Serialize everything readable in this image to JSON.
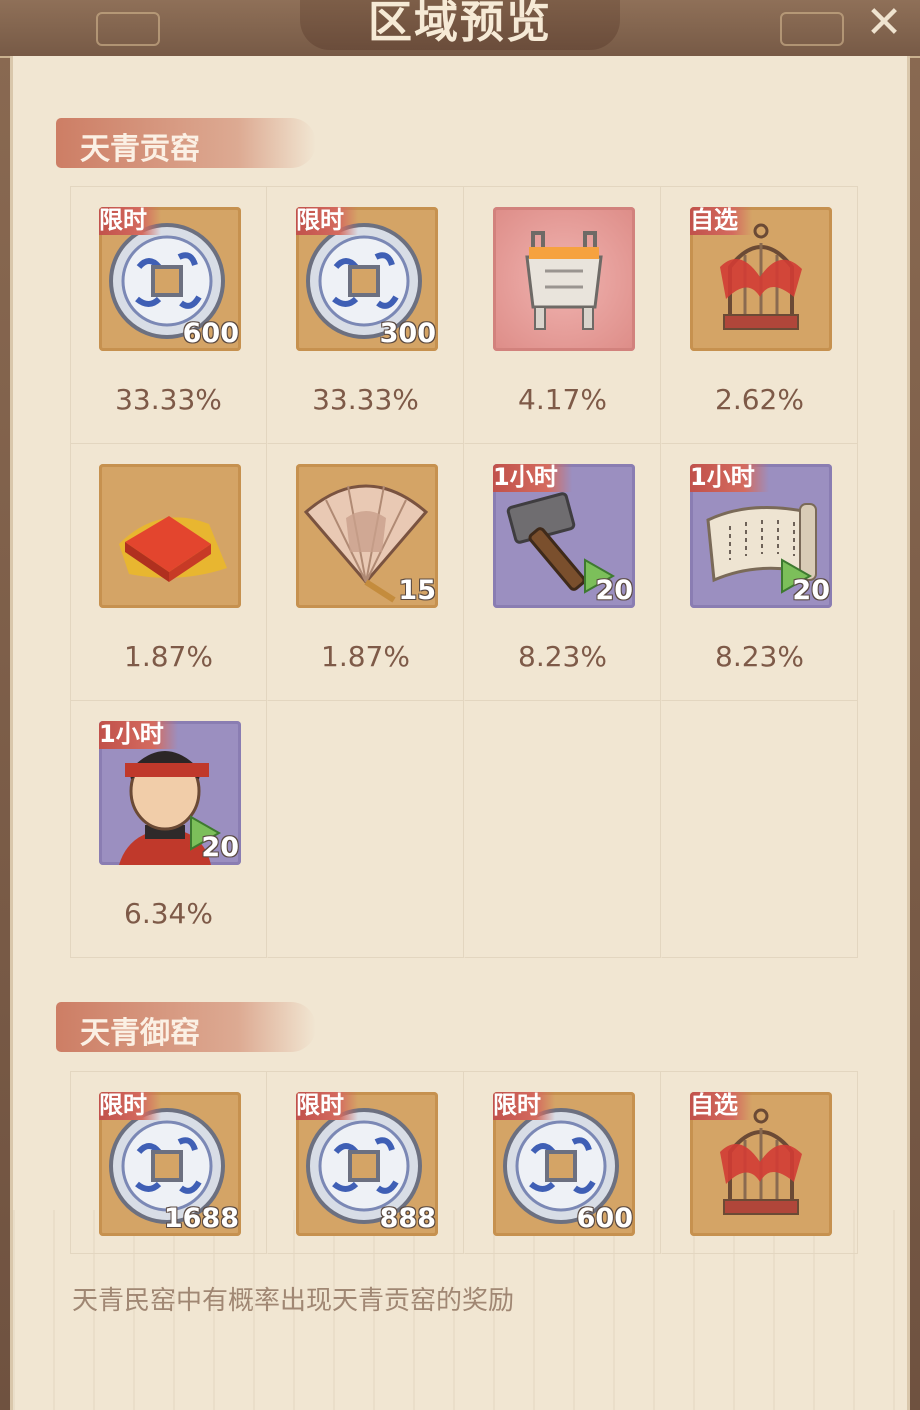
{
  "header": {
    "title": "区域预览"
  },
  "sections": [
    {
      "label": "天青贡窑",
      "items": [
        {
          "icon": "coin-icon",
          "tag": "限时",
          "qty": "600",
          "rate": "33.33%",
          "bg": "gold"
        },
        {
          "icon": "coin-icon",
          "tag": "限时",
          "qty": "300",
          "rate": "33.33%",
          "bg": "gold"
        },
        {
          "icon": "bronze-ding-icon",
          "tag": "",
          "qty": "",
          "rate": "4.17%",
          "bg": "red"
        },
        {
          "icon": "birdcage-icon",
          "tag": "自选",
          "qty": "",
          "rate": "2.62%",
          "bg": "gold"
        },
        {
          "icon": "red-fabric-icon",
          "tag": "",
          "qty": "",
          "rate": "1.87%",
          "bg": "gold"
        },
        {
          "icon": "folding-fan-icon",
          "tag": "",
          "qty": "15",
          "rate": "1.87%",
          "bg": "gold"
        },
        {
          "icon": "hammer-speedup-icon",
          "tag": "1小时",
          "qty": "20",
          "rate": "8.23%",
          "bg": "purple"
        },
        {
          "icon": "scroll-speedup-icon",
          "tag": "1小时",
          "qty": "20",
          "rate": "8.23%",
          "bg": "purple"
        },
        {
          "icon": "worker-speedup-icon",
          "tag": "1小时",
          "qty": "20",
          "rate": "6.34%",
          "bg": "purple"
        }
      ]
    },
    {
      "label": "天青御窑",
      "items": [
        {
          "icon": "coin-icon",
          "tag": "限时",
          "qty": "1688",
          "rate": "",
          "bg": "gold"
        },
        {
          "icon": "coin-icon",
          "tag": "限时",
          "qty": "888",
          "rate": "",
          "bg": "gold"
        },
        {
          "icon": "coin-icon",
          "tag": "限时",
          "qty": "600",
          "rate": "",
          "bg": "gold"
        },
        {
          "icon": "birdcage-icon",
          "tag": "自选",
          "qty": "",
          "rate": "",
          "bg": "gold"
        }
      ]
    }
  ],
  "footnote": "天青民窑中有概率出现天青贡窑的奖励"
}
